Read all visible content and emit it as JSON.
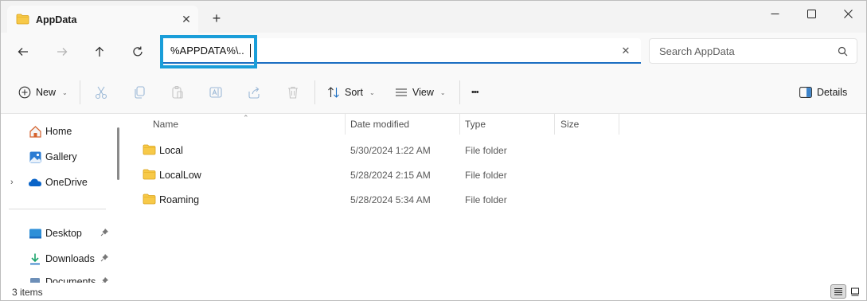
{
  "window": {
    "tab_title": "AppData",
    "close_tab_glyph": "✕",
    "new_tab_glyph": "+"
  },
  "navigation": {
    "address_value": "%APPDATA%\\..",
    "clear_glyph": "✕",
    "search_placeholder": "Search AppData"
  },
  "commands": {
    "new_label": "New",
    "sort_label": "Sort",
    "view_label": "View",
    "more_glyph": "•••",
    "details_label": "Details"
  },
  "sidebar": {
    "items": [
      {
        "label": "Home",
        "icon": "home-icon"
      },
      {
        "label": "Gallery",
        "icon": "gallery-icon"
      },
      {
        "label": "OneDrive",
        "icon": "onedrive-icon"
      },
      {
        "label": "Desktop",
        "icon": "desktop-icon"
      },
      {
        "label": "Downloads",
        "icon": "downloads-icon"
      },
      {
        "label": "Documents",
        "icon": "documents-icon"
      }
    ]
  },
  "filelist": {
    "columns": [
      "Name",
      "Date modified",
      "Type",
      "Size"
    ],
    "rows": [
      {
        "name": "Local",
        "date": "5/30/2024 1:22 AM",
        "type": "File folder"
      },
      {
        "name": "LocalLow",
        "date": "5/28/2024 2:15 AM",
        "type": "File folder"
      },
      {
        "name": "Roaming",
        "date": "5/28/2024 5:34 AM",
        "type": "File folder"
      }
    ]
  },
  "status": {
    "count_text": "3 items"
  },
  "colors": {
    "accent": "#1b6ec2",
    "highlight_box": "#1a9ed9",
    "folder_yellow": "#f7c948"
  }
}
